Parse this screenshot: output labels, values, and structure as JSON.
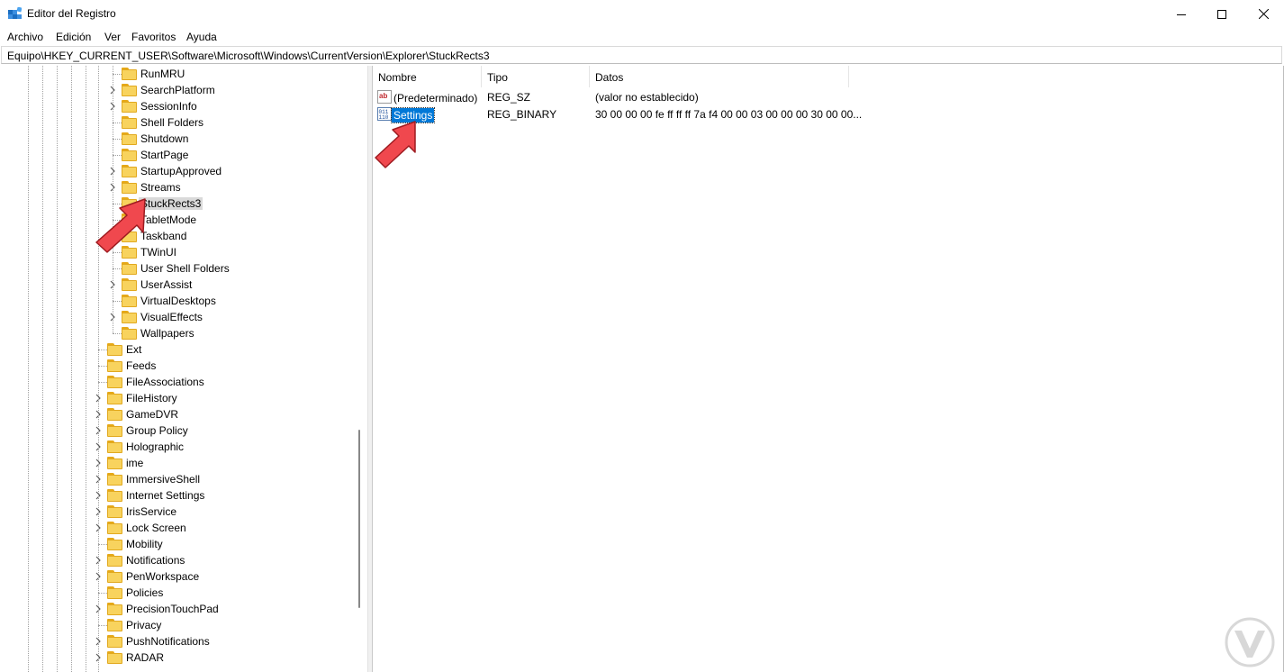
{
  "window": {
    "title": "Editor del Registro",
    "controls": [
      "minimize",
      "maximize",
      "close"
    ]
  },
  "menu": [
    "Archivo",
    "Edición",
    "Ver",
    "Favoritos",
    "Ayuda"
  ],
  "address": "Equipo\\HKEY_CURRENT_USER\\Software\\Microsoft\\Windows\\CurrentVersion\\Explorer\\StuckRects3",
  "tree": {
    "level2": [
      {
        "label": "RunMRU",
        "expandable": false
      },
      {
        "label": "SearchPlatform",
        "expandable": true
      },
      {
        "label": "SessionInfo",
        "expandable": true
      },
      {
        "label": "Shell Folders",
        "expandable": false
      },
      {
        "label": "Shutdown",
        "expandable": false
      },
      {
        "label": "StartPage",
        "expandable": false
      },
      {
        "label": "StartupApproved",
        "expandable": true
      },
      {
        "label": "Streams",
        "expandable": true
      },
      {
        "label": "StuckRects3",
        "expandable": false,
        "selected": true
      },
      {
        "label": "TabletMode",
        "expandable": false
      },
      {
        "label": "Taskband",
        "expandable": false
      },
      {
        "label": "TWinUI",
        "expandable": false
      },
      {
        "label": "User Shell Folders",
        "expandable": false
      },
      {
        "label": "UserAssist",
        "expandable": true
      },
      {
        "label": "VirtualDesktops",
        "expandable": false
      },
      {
        "label": "VisualEffects",
        "expandable": true
      },
      {
        "label": "Wallpapers",
        "expandable": false
      }
    ],
    "level1": [
      {
        "label": "Ext",
        "expandable": false
      },
      {
        "label": "Feeds",
        "expandable": false
      },
      {
        "label": "FileAssociations",
        "expandable": false
      },
      {
        "label": "FileHistory",
        "expandable": true
      },
      {
        "label": "GameDVR",
        "expandable": true
      },
      {
        "label": "Group Policy",
        "expandable": true
      },
      {
        "label": "Holographic",
        "expandable": true
      },
      {
        "label": "ime",
        "expandable": true
      },
      {
        "label": "ImmersiveShell",
        "expandable": true
      },
      {
        "label": "Internet Settings",
        "expandable": true
      },
      {
        "label": "IrisService",
        "expandable": true
      },
      {
        "label": "Lock Screen",
        "expandable": true
      },
      {
        "label": "Mobility",
        "expandable": false
      },
      {
        "label": "Notifications",
        "expandable": true
      },
      {
        "label": "PenWorkspace",
        "expandable": true
      },
      {
        "label": "Policies",
        "expandable": false
      },
      {
        "label": "PrecisionTouchPad",
        "expandable": true
      },
      {
        "label": "Privacy",
        "expandable": false
      },
      {
        "label": "PushNotifications",
        "expandable": true
      },
      {
        "label": "RADAR",
        "expandable": true
      }
    ]
  },
  "list": {
    "columns": [
      "Nombre",
      "Tipo",
      "Datos"
    ],
    "rows": [
      {
        "icon": "string-value-icon",
        "name": "(Predeterminado)",
        "type": "REG_SZ",
        "data": "(valor no establecido)",
        "selected": false
      },
      {
        "icon": "binary-value-icon",
        "name": "Settings",
        "type": "REG_BINARY",
        "data": "30 00 00 00 fe ff ff ff 7a f4 00 00 03 00 00 00 30 00 00...",
        "selected": true
      }
    ]
  },
  "colors": {
    "selection_blue": "#0078d7",
    "tree_selection": "#d9d9d9",
    "folder_yellow": "#f8d35e",
    "arrow_red": "#f0484e"
  }
}
